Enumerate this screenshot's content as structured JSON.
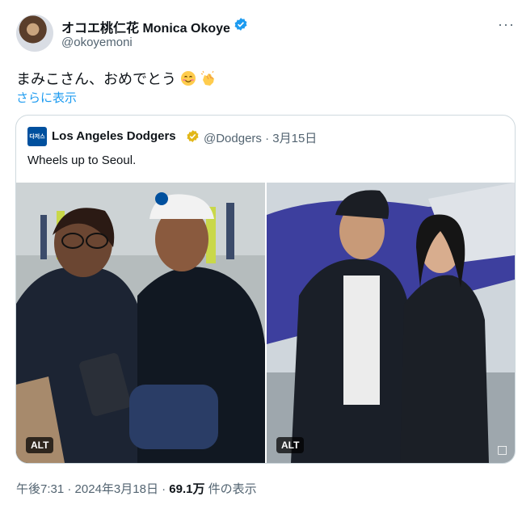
{
  "author": {
    "display_name": "オコエ桃仁花 Monica Okoye",
    "handle": "@okoyemoni"
  },
  "more_glyph": "···",
  "tweet": {
    "text": "まみこさん、おめでとう",
    "emojis": [
      "smiling-face-icon",
      "clapping-hands-icon"
    ],
    "show_more": "さらに表示"
  },
  "quoted": {
    "logo_text": "다저스",
    "name": "Los Angeles Dodgers",
    "handle": "@Dodgers",
    "separator": "·",
    "date": "3月15日",
    "text": "Wheels up to Seoul.",
    "photos": [
      {
        "alt_label": "ALT"
      },
      {
        "alt_label": "ALT"
      }
    ]
  },
  "footer": {
    "time": "午後7:31",
    "separator": "·",
    "date": "2024年3月18日",
    "views_count": "69.1万",
    "views_label": "件の表示"
  },
  "colors": {
    "verified_blue": "#1d9bf0",
    "verified_gold": "#e2b719",
    "link_blue": "#1d9bf0",
    "dodgers_blue": "#00509e"
  }
}
